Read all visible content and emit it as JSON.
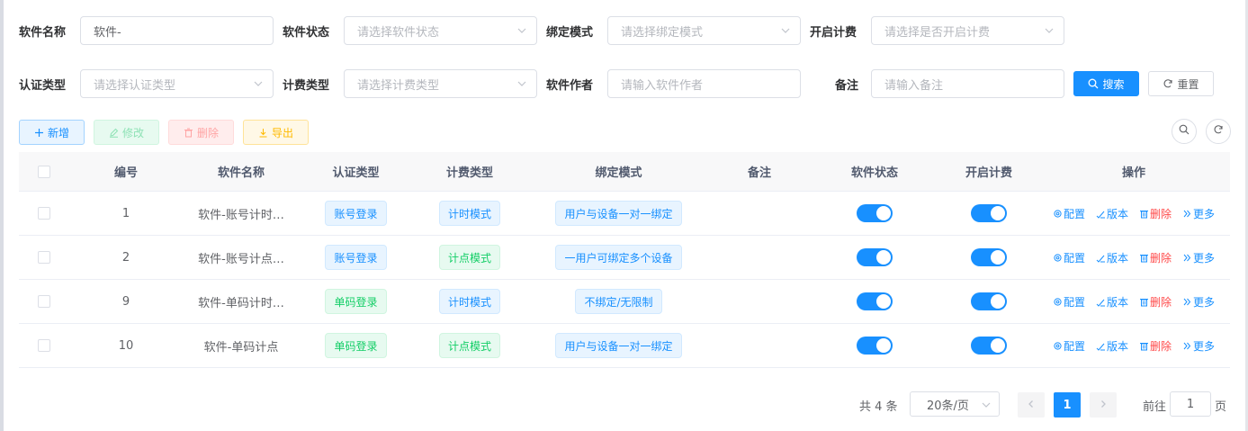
{
  "filters": {
    "row1": [
      {
        "label": "软件名称",
        "value": "软件-",
        "placeholder": ""
      },
      {
        "label": "软件状态",
        "value": "",
        "placeholder": "请选择软件状态"
      },
      {
        "label": "绑定模式",
        "value": "",
        "placeholder": "请选择绑定模式"
      },
      {
        "label": "开启计费",
        "value": "",
        "placeholder": "请选择是否开启计费"
      }
    ],
    "row2": [
      {
        "label": "认证类型",
        "value": "",
        "placeholder": "请选择认证类型"
      },
      {
        "label": "计费类型",
        "value": "",
        "placeholder": "请选择计费类型"
      },
      {
        "label": "软件作者",
        "value": "",
        "placeholder": "请输入软件作者"
      },
      {
        "label": "备注",
        "value": "",
        "placeholder": "请输入备注"
      }
    ],
    "search_label": "搜索",
    "reset_label": "重置"
  },
  "toolbar": {
    "add_label": "新增",
    "edit_label": "修改",
    "delete_label": "删除",
    "export_label": "导出"
  },
  "table": {
    "columns": [
      "编号",
      "软件名称",
      "认证类型",
      "计费类型",
      "绑定模式",
      "备注",
      "软件状态",
      "开启计费",
      "操作"
    ],
    "rows": [
      {
        "id": "1",
        "name": "软件-账号计时…",
        "auth": "账号登录",
        "bill": "计时模式",
        "bind": "用户与设备一对一绑定",
        "note": "",
        "status_on": true,
        "fee_on": true
      },
      {
        "id": "2",
        "name": "软件-账号计点…",
        "auth": "账号登录",
        "bill": "计点模式",
        "bind": "一用户可绑定多个设备",
        "note": "",
        "status_on": true,
        "fee_on": true
      },
      {
        "id": "9",
        "name": "软件-单码计时…",
        "auth": "单码登录",
        "bill": "计时模式",
        "bind": "不绑定/无限制",
        "note": "",
        "status_on": true,
        "fee_on": true
      },
      {
        "id": "10",
        "name": "软件-单码计点",
        "auth": "单码登录",
        "bill": "计点模式",
        "bind": "用户与设备一对一绑定",
        "note": "",
        "status_on": true,
        "fee_on": true
      }
    ],
    "ops": {
      "config": "配置",
      "version": "版本",
      "delete": "删除",
      "more": "更多"
    }
  },
  "pagination": {
    "total": "共 4 条",
    "page_size": "20条/页",
    "current": "1",
    "goto_prefix": "前往",
    "goto_value": "1",
    "goto_suffix": "页"
  },
  "colors": {
    "primary": "#1890ff",
    "success": "#13ce66",
    "danger": "#ff4949",
    "warning": "#ffba00"
  }
}
